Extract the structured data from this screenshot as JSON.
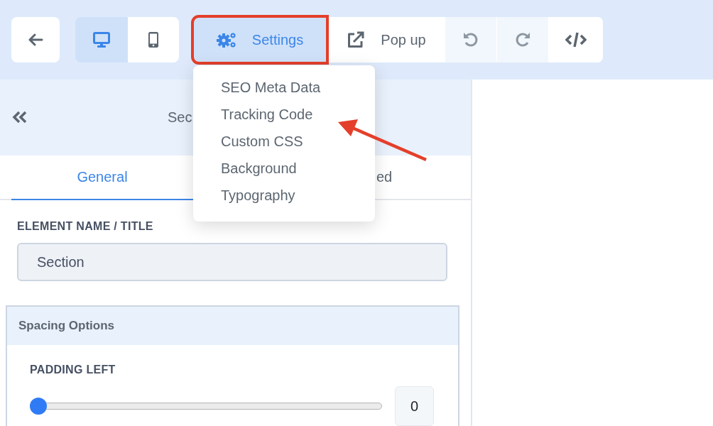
{
  "toolbar": {
    "device_buttons": [
      {
        "kind": "desktop",
        "selected": true
      },
      {
        "kind": "mobile",
        "selected": false
      }
    ],
    "settings_button": {
      "label": "Settings",
      "highlighted": true
    },
    "popup_button": {
      "label": "Pop up"
    }
  },
  "settings_menu": {
    "items": [
      {
        "label": "SEO Meta Data"
      },
      {
        "label": "Tracking Code",
        "pointed": true
      },
      {
        "label": "Custom CSS"
      },
      {
        "label": "Background"
      },
      {
        "label": "Typography"
      }
    ]
  },
  "panel": {
    "title": "Sec",
    "tabs": [
      {
        "label": "General",
        "selected": true
      },
      {
        "label": "ed",
        "selected": false
      }
    ],
    "element_name": {
      "label": "ELEMENT NAME / TITLE",
      "value": "Section"
    },
    "spacing": {
      "title": "Spacing Options",
      "padding_left": {
        "label": "PADDING LEFT",
        "level": 0,
        "value": "0"
      }
    }
  }
}
